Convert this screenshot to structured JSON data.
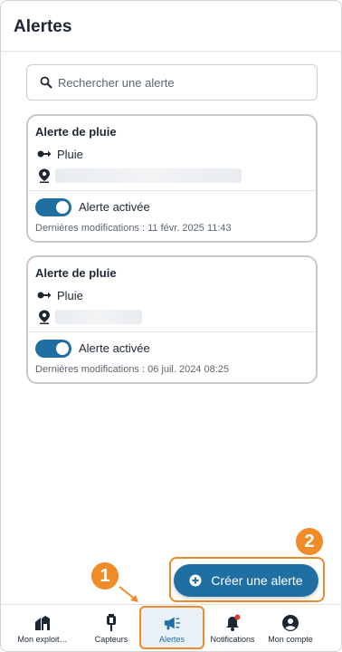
{
  "header": {
    "title": "Alertes"
  },
  "search": {
    "placeholder": "Rechercher une alerte",
    "icon": "search-icon"
  },
  "alerts": [
    {
      "title": "Alerte de pluie",
      "sensor": "Pluie",
      "toggle_label": "Alerte activée",
      "enabled": true,
      "modified": "Dernières modifications : 11 févr. 2025 11:43"
    },
    {
      "title": "Alerte de pluie",
      "sensor": "Pluie",
      "toggle_label": "Alerte activée",
      "enabled": true,
      "modified": "Dernières modifications : 06 juil. 2024 08:25"
    }
  ],
  "fab": {
    "label": "Créer une alerte"
  },
  "markers": {
    "one": "1",
    "two": "2"
  },
  "nav": [
    {
      "label": "Mon exploit…",
      "icon": "farm-icon",
      "active": false
    },
    {
      "label": "Capteurs",
      "icon": "sensor-icon",
      "active": false
    },
    {
      "label": "Alertes",
      "icon": "megaphone-icon",
      "active": true
    },
    {
      "label": "Notifications",
      "icon": "bell-icon",
      "active": false
    },
    {
      "label": "Mon compte",
      "icon": "account-icon",
      "active": false
    }
  ],
  "colors": {
    "accent": "#1f6fa3",
    "highlight": "#ef8a2a",
    "notification_dot": "#e53935"
  }
}
